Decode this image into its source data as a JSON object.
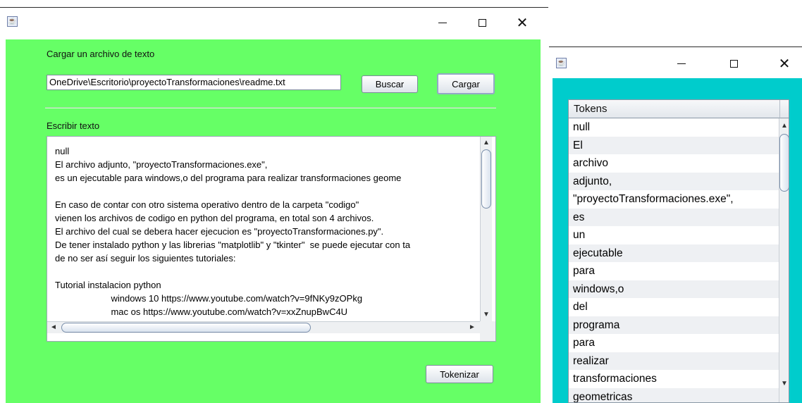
{
  "main_window": {
    "load_label": "Cargar un archivo de texto",
    "file_path": "OneDrive\\Escritorio\\proyectoTransformaciones\\readme.txt",
    "search_button": "Buscar",
    "load_button": "Cargar",
    "write_label": "Escribir texto",
    "text_lines": [
      "null",
      "El archivo adjunto, \"proyectoTransformaciones.exe\",",
      "es un ejecutable para windows,o del programa para realizar transformaciones geome",
      "",
      "En caso de contar con otro sistema operativo dentro de la carpeta \"codigo\"",
      "vienen los archivos de codigo en python del programa, en total son 4 archivos.",
      "El archivo del cual se debera hacer ejecucion es \"proyectoTransformaciones.py\".",
      "De tener instalado python y las librerias \"matplotlib\" y \"tkinter\"  se puede ejecutar con ta",
      "de no ser así seguir los siguientes tutoriales:",
      "",
      "Tutorial instalacion python",
      "                      windows 10 https://www.youtube.com/watch?v=9fNKy9zOPkg",
      "                      mac os https://www.youtube.com/watch?v=xxZnupBwC4U"
    ],
    "tokenize_button": "Tokenizar",
    "icons": {
      "app": "java-coffee-icon",
      "minimize": "minimize-icon",
      "maximize": "maximize-icon",
      "close": "close-icon"
    },
    "background_color": "#66ff66"
  },
  "tokens_window": {
    "column_header": "Tokens",
    "tokens": [
      "null",
      "El",
      "archivo",
      "adjunto,",
      "\"proyectoTransformaciones.exe\",",
      "es",
      "un",
      "ejecutable",
      "para",
      "windows,o",
      "del",
      "programa",
      "para",
      "realizar",
      "transformaciones",
      "geometricas"
    ],
    "background_color": "#00cccc"
  }
}
